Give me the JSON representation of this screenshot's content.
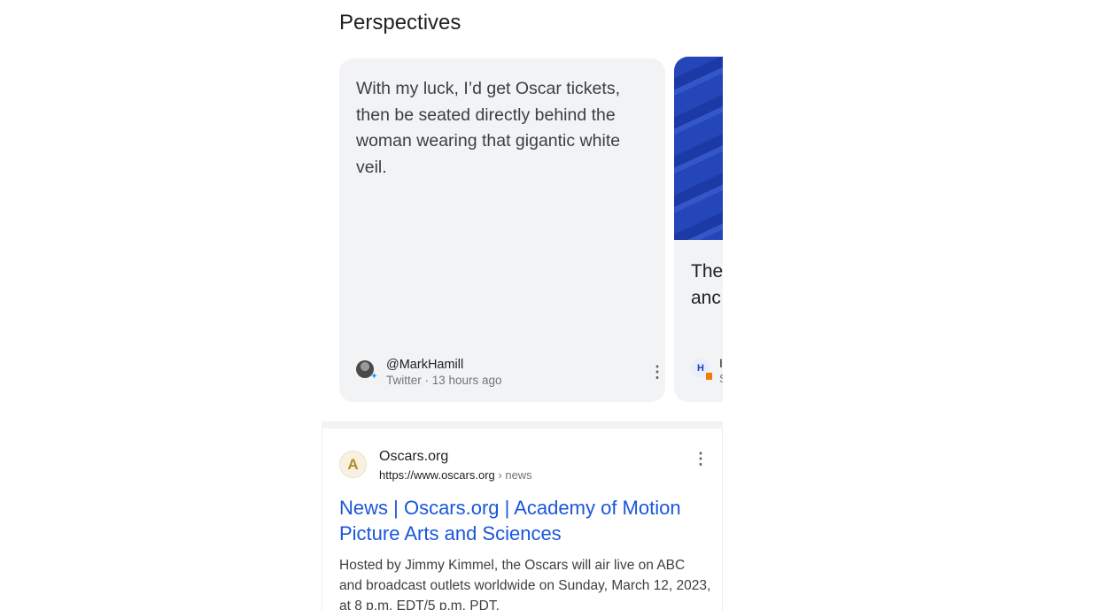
{
  "perspectives": {
    "title": "Perspectives",
    "quote_card": {
      "text": "With my luck, I’d get Oscar tickets, then be seated directly behind the woman wearing that gigantic white veil.",
      "author": "@MarkHamill",
      "meta": "Twitter · 13 hours ago",
      "avatar_icon": "user-avatar-icon",
      "source_icon": "twitter-icon",
      "more_icon": "more-vert-icon"
    },
    "next_card": {
      "title_partial": "The\nanc",
      "badge_letter": "H",
      "name_stub": "I",
      "meta_stub": "S"
    }
  },
  "result": {
    "logo_letter": "A",
    "site_name": "Oscars.org",
    "url": "https://www.oscars.org",
    "url_crumb": " › news",
    "title": "News | Oscars.org | Academy of Motion Picture Arts and Sciences",
    "snippet": "Hosted by Jimmy Kimmel, the Oscars will air live on ABC and broadcast outlets worldwide on Sunday, March 12, 2023, at 8 p.m. EDT/5 p.m. PDT.",
    "more_icon": "more-vert-icon"
  },
  "colors": {
    "link": "#1a56db",
    "card_bg": "#f2f3f5",
    "twitter": "#1d9bf0",
    "accent_gold": "#b58a1e"
  }
}
